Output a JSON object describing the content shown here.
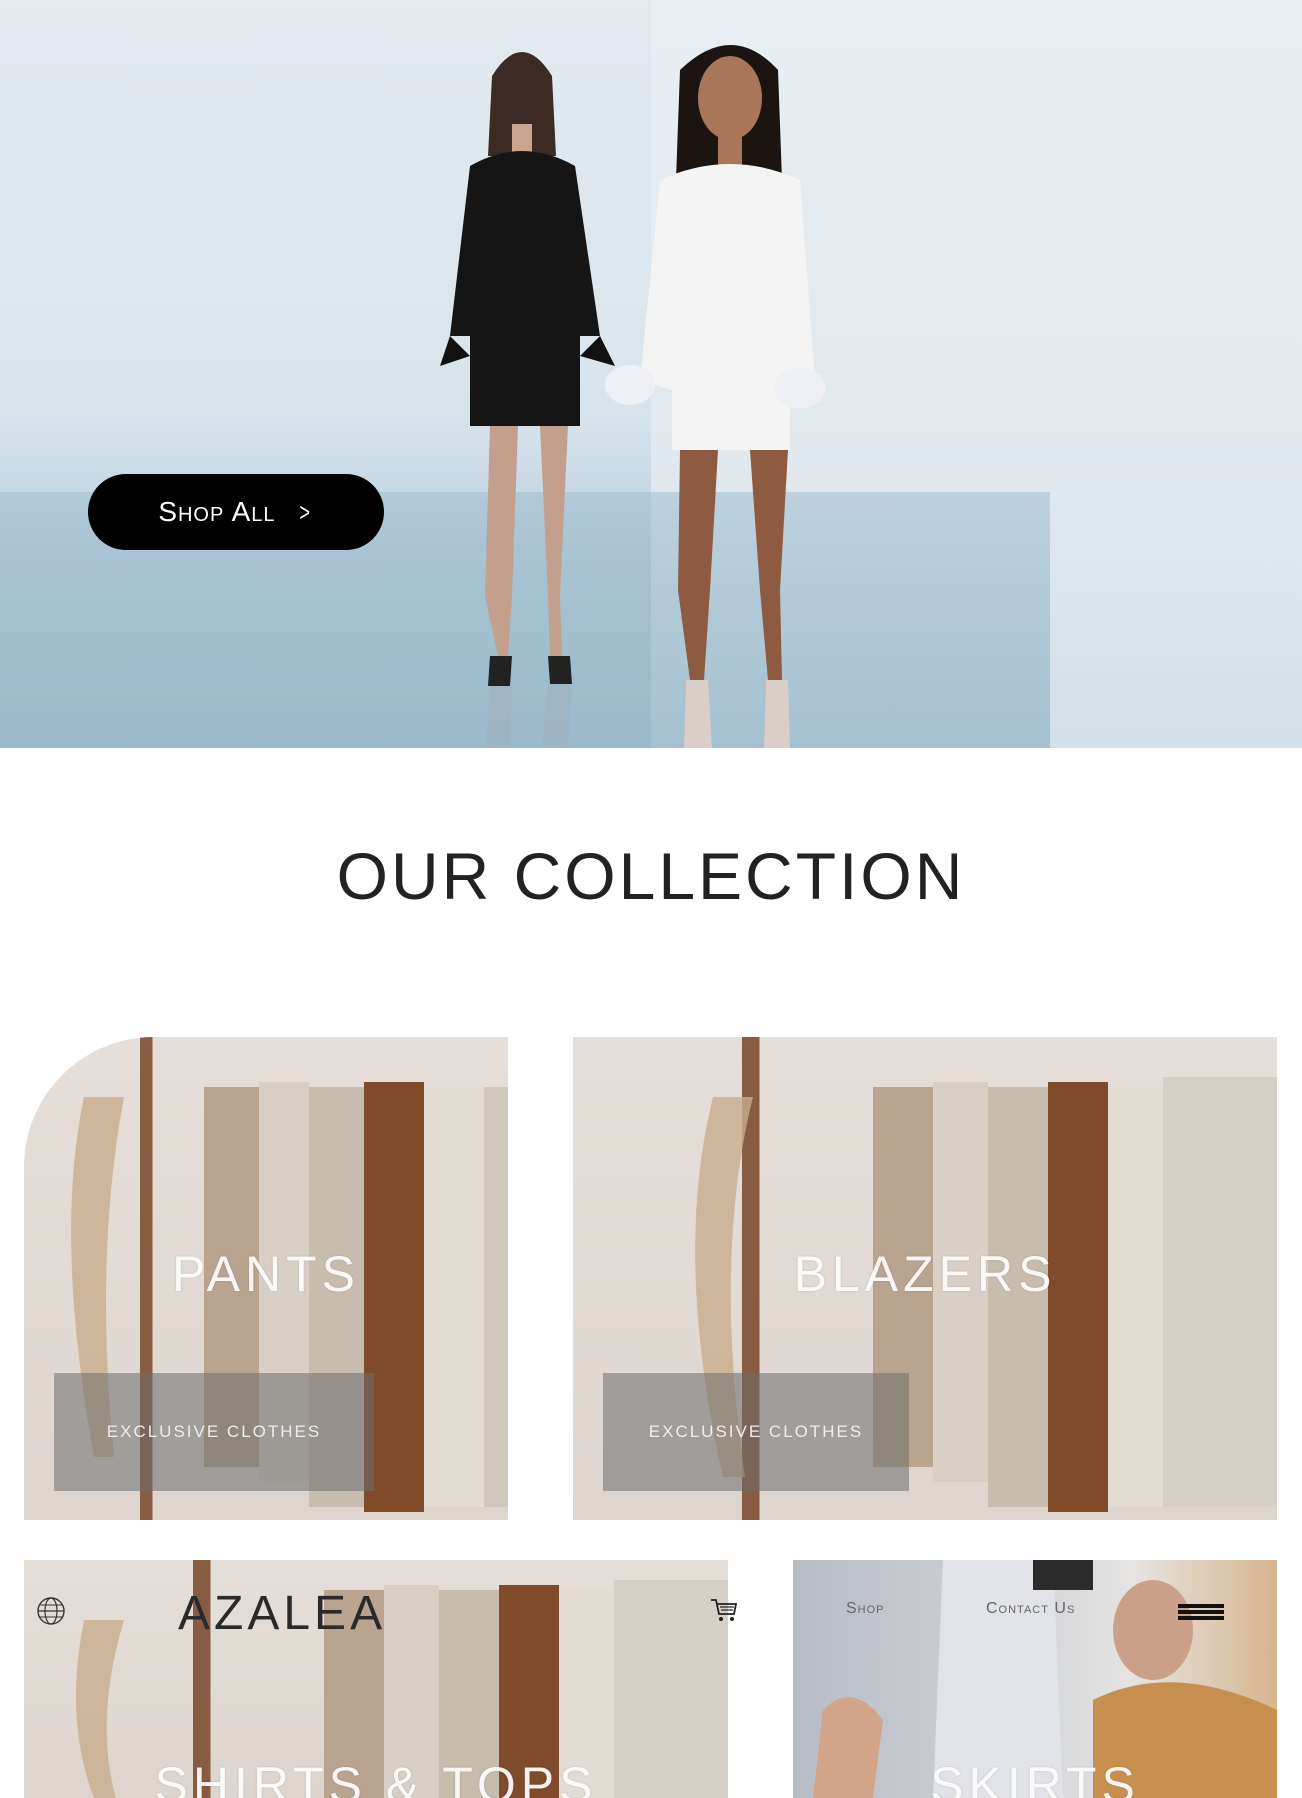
{
  "hero": {
    "cta_label": "Shop All"
  },
  "collection": {
    "title": "OUR COLLECTION"
  },
  "cards": [
    {
      "label": "PANTS",
      "tag": "EXCLUSIVE CLOTHES"
    },
    {
      "label": "BLAZERS",
      "tag": "EXCLUSIVE CLOTHES"
    },
    {
      "label": "SHIRTS & TOPS"
    },
    {
      "label": "SKIRTS"
    }
  ],
  "nav": {
    "logo": "AZALEA",
    "links": [
      "Shop",
      "Contact Us"
    ]
  },
  "colors": {
    "cta_bg": "#000000",
    "accent_text": "#222222"
  },
  "icons": [
    "globe-icon",
    "cart-icon",
    "menu-icon",
    "chevron-right-icon"
  ]
}
